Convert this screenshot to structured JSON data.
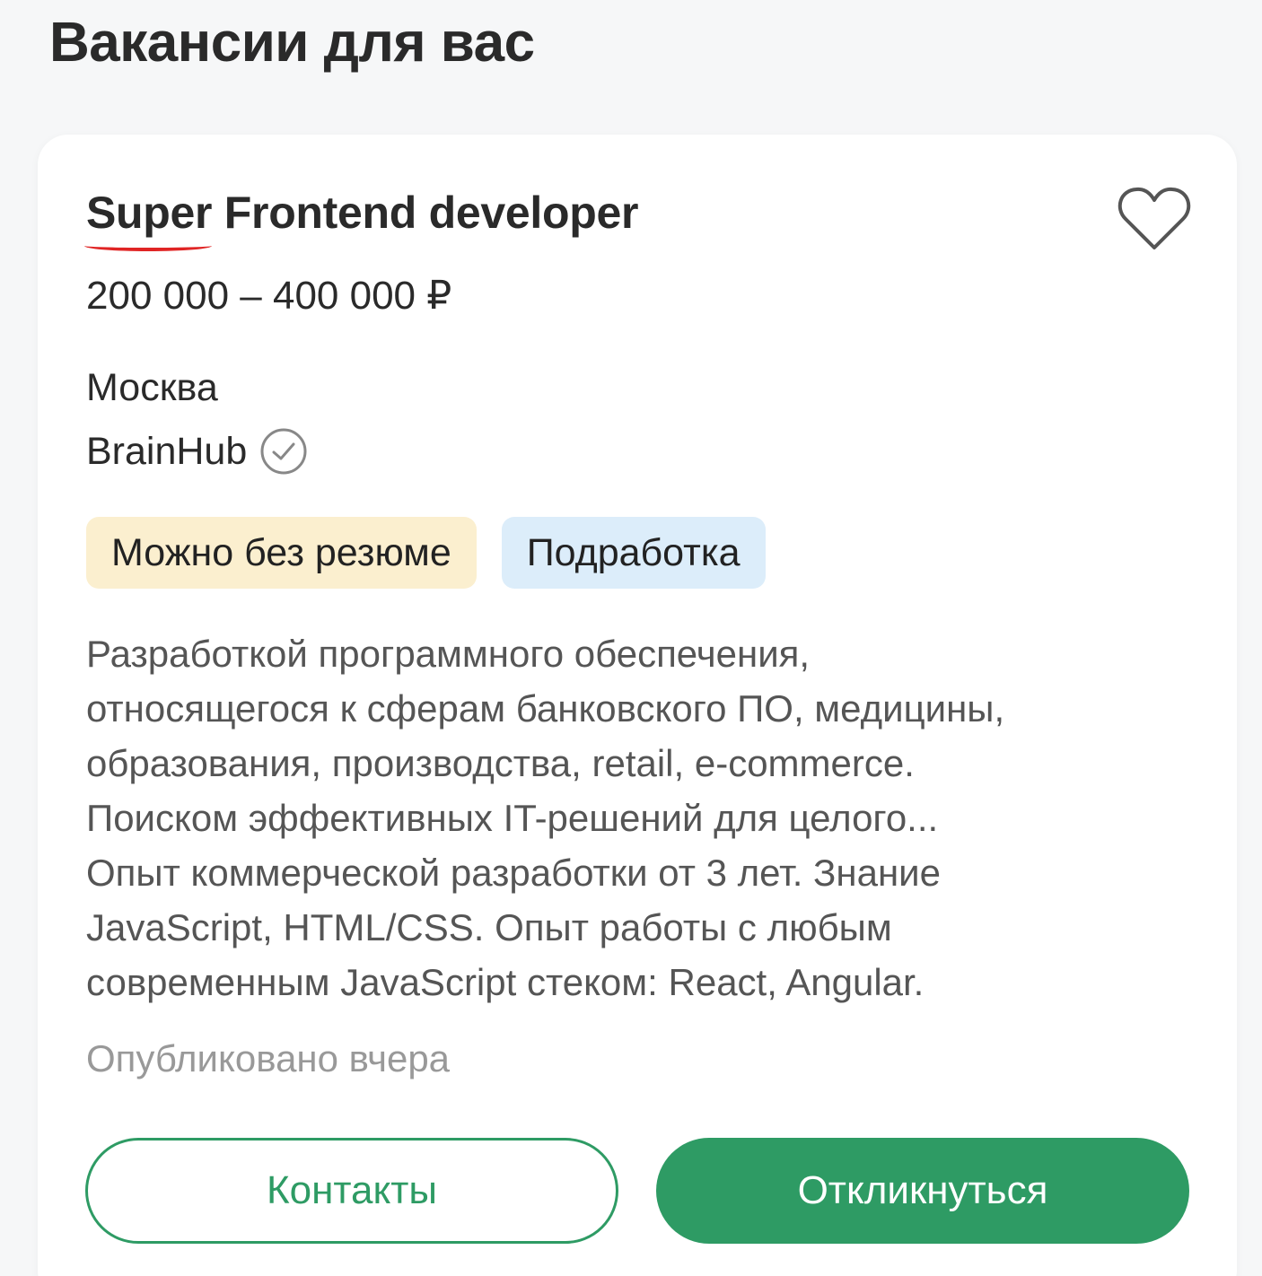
{
  "section": {
    "title": "Вакансии для вас"
  },
  "vacancy": {
    "title": "Super Frontend developer",
    "salary": "200 000 – 400 000 ₽",
    "city": "Москва",
    "company": "BrainHub",
    "company_verified_icon": "check-circle-icon",
    "favorite_icon": "heart-outline-icon",
    "tags": [
      {
        "label": "Можно без резюме",
        "color": "#fbefcf"
      },
      {
        "label": "Подработка",
        "color": "#dcedfa"
      }
    ],
    "description_lines": [
      "Разработкой программного обеспечения,",
      "относящегося к сферам банковского ПО, медицины,",
      "образования, производства, retail, e-commerce.",
      "Поиском эффективных IT-решений для целого...",
      "Опыт коммерческой разработки от 3 лет. Знание",
      "JavaScript, HTML/CSS. Опыт работы с любым",
      "современным JavaScript стеком: React, Angular."
    ],
    "published": "Опубликовано вчера"
  },
  "actions": {
    "contacts_label": "Контакты",
    "apply_label": "Откликнуться"
  },
  "colors": {
    "accent": "#2e9b64",
    "spellcheck_underline": "#e02424"
  }
}
